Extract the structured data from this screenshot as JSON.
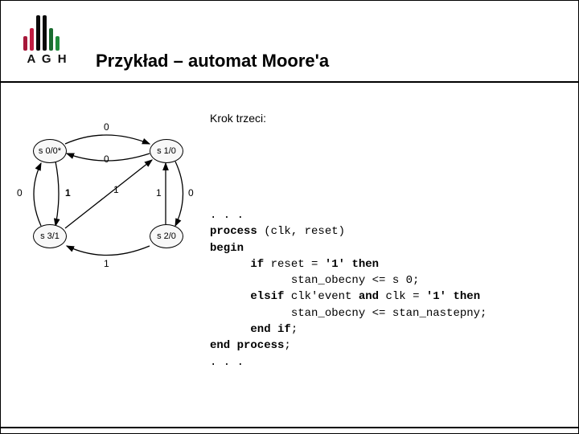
{
  "header": {
    "logo_text": "A G H",
    "title": "Przykład – automat Moore'a"
  },
  "step_label": "Krok trzeci:",
  "diagram": {
    "nodes": {
      "s0": "s 0/0*",
      "s1": "s 1/0",
      "s2": "s 2/0",
      "s3": "s 3/1"
    },
    "edge_labels": {
      "s0_s1_top": "0",
      "s1_s0_mid": "0",
      "s1_s2_right": "0",
      "s2_s3_bottom": "1",
      "s3_s0_left": "0",
      "s0_s3_diag": "1",
      "s2_s1_up": "1",
      "s3_s1_cross": "1"
    }
  },
  "code": {
    "l1": ". . .",
    "l2a": "process",
    "l2b": " (clk, reset)",
    "l3": "begin",
    "l4a": "      if",
    "l4b": " reset = ",
    "l4c": "'1'",
    "l4d": " then",
    "l5": "            stan_obecny <= s 0;",
    "l6a": "      elsif",
    "l6b": " clk'event ",
    "l6c": "and",
    "l6d": " clk = ",
    "l6e": "'1'",
    "l6f": " then",
    "l7": "            stan_obecny <= stan_nastepny;",
    "l8a": "      end if",
    "l8b": ";",
    "l9a": "end process",
    "l9b": ";",
    "l10": ". . ."
  }
}
